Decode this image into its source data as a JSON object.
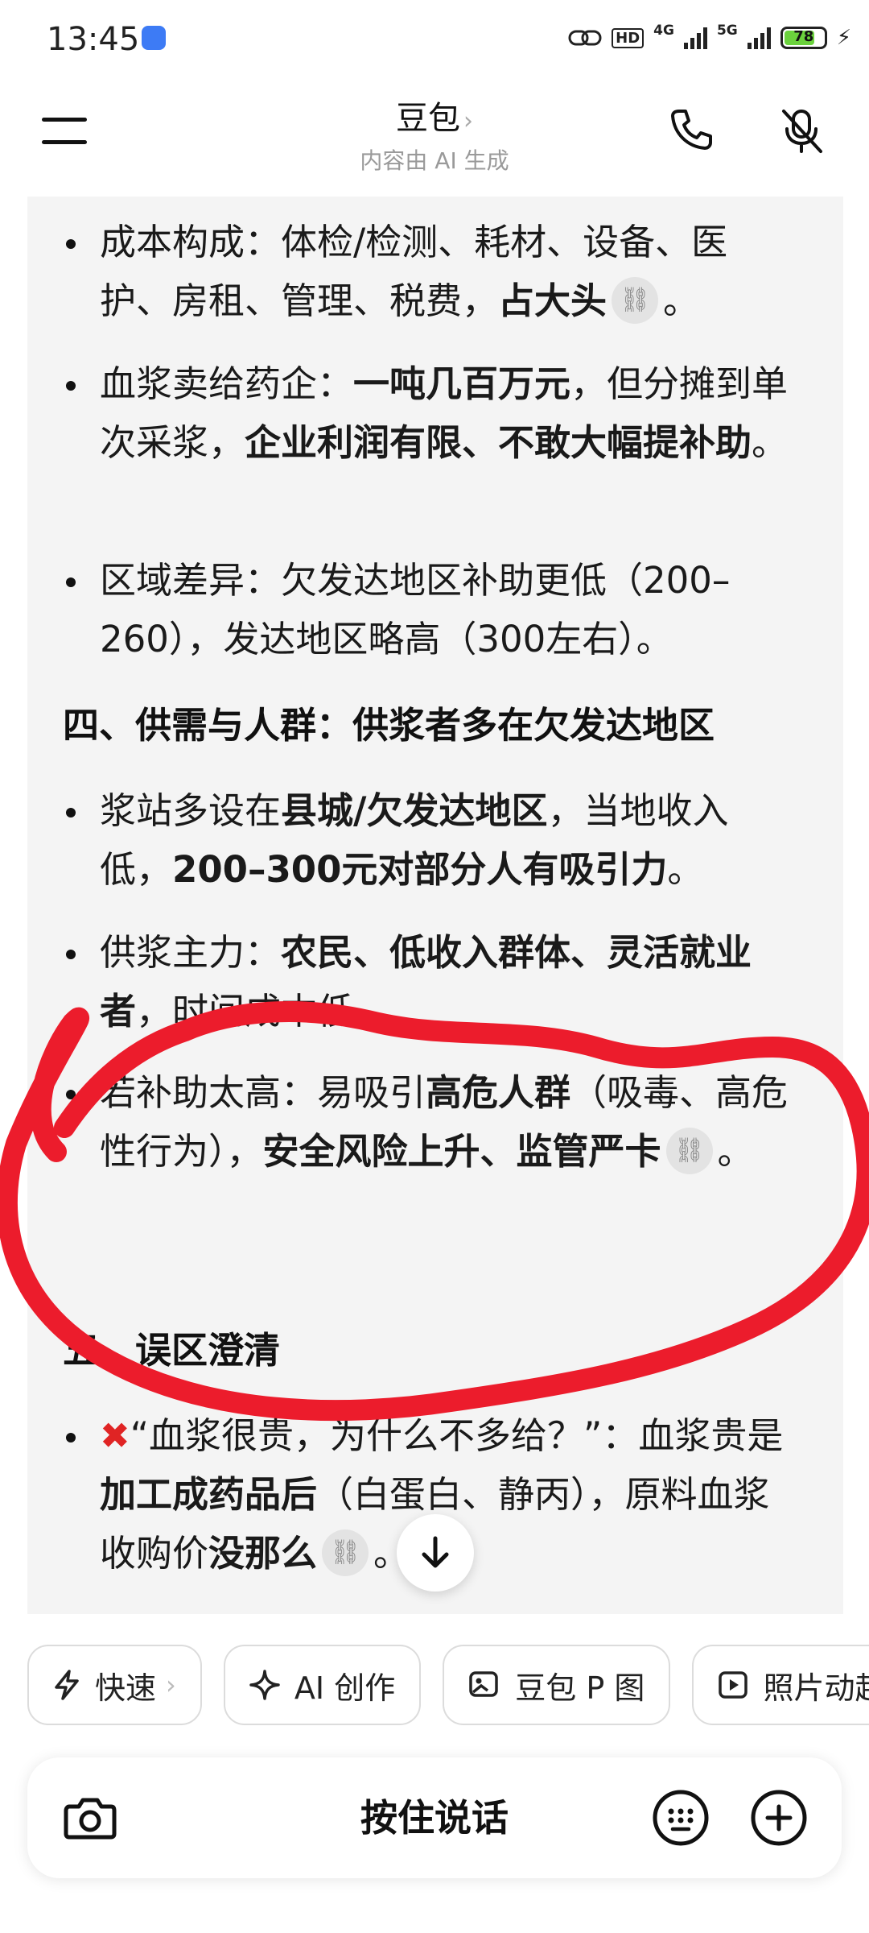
{
  "status_bar": {
    "time": "13:45",
    "hd_label": "HD",
    "net1_label": "4G",
    "net2_label": "5G",
    "battery": "78",
    "battery_fill": 0.78,
    "battery_color": "#6bd23d"
  },
  "header": {
    "title": "豆包",
    "title_chevron": "›",
    "subtitle": "内容由 AI 生成",
    "icons": [
      "menu-icon",
      "phone-icon",
      "mute-icon"
    ]
  },
  "message": {
    "b1": {
      "t1": "成本构成：体检/检测、耗材、设备、医护、房租、管理、税费，",
      "t2": "占大头",
      "t3": "。"
    },
    "b2": {
      "t1": "血浆卖给药企：",
      "t2": "一吨几百万元",
      "t3": "，但分摊到单次采浆，",
      "t4": "企业利润有限、不敢大幅提补助",
      "t5": "。"
    },
    "b3": {
      "t1": "区域差异：欠发达地区补助更低（200–260），发达地区略高（300左右）。"
    },
    "sec4": "四、供需与人群：供浆者多在欠发达地区",
    "b4": {
      "t1": "浆站多设在",
      "t2": "县城/欠发达地区",
      "t3": "，当地收入低，",
      "t4": "200–300元对部分人有吸引力",
      "t5": "。"
    },
    "b5": {
      "t1": "供浆主力：",
      "t2": "农民、低收入群体、灵活就业者",
      "t3": "，时间成本低。"
    },
    "b6": {
      "t1": "若补助太高：易吸引",
      "t2": "高危人群",
      "t3": "（吸毒、高危性行为），",
      "t4": "安全风险上升、监管严卡",
      "t5": "。"
    },
    "sec5": "五、误区澄清",
    "b7": {
      "t1": "“血浆很贵，为什么不多给？”：血浆贵是",
      "t2": "加工成药品后",
      "t3": "（白蛋白、静丙），原料血浆收购价",
      "t4": "没那么",
      "t5": "。"
    },
    "cite_icon": "link-icon",
    "cross_icon": "red-cross-icon"
  },
  "chips": [
    {
      "label": "快速",
      "icon": "lightning-icon",
      "chevron": "›"
    },
    {
      "label": "AI 创作",
      "icon": "sparkle-icon"
    },
    {
      "label": "豆包 P 图",
      "icon": "image-edit-icon"
    },
    {
      "label": "照片动起来",
      "icon": "play-icon"
    }
  ],
  "input_bar": {
    "hold_to_talk": "按住说话",
    "icons": [
      "camera-icon",
      "keyboard-icon",
      "plus-icon"
    ]
  },
  "colors": {
    "annotation_red": "#ec1c2c",
    "card_bg": "#f4f4f4"
  }
}
